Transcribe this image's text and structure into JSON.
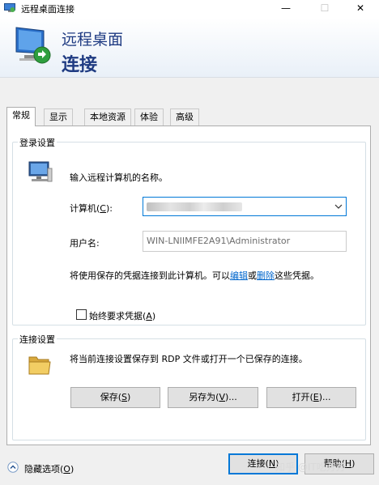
{
  "window": {
    "title": "远程桌面连接"
  },
  "header": {
    "line1": "远程桌面",
    "line2": "连接"
  },
  "tabs": [
    "常规",
    "显示",
    "本地资源",
    "体验",
    "高级"
  ],
  "login_group": {
    "title": "登录设置",
    "prompt": "输入远程计算机的名称。",
    "computer_label_prefix": "计算机(",
    "computer_label_key": "C",
    "computer_label_suffix": "):",
    "username_label": "用户名:",
    "username_value": "WIN-LNIIMFE2A91\\Administrator",
    "cred_text_1": "将使用保存的凭据连接到此计算机。可以",
    "cred_link_edit": "编辑",
    "cred_text_2": "或",
    "cred_link_delete": "删除",
    "cred_text_3": "这些凭据。",
    "checkbox_prefix": "始终要求凭据(",
    "checkbox_key": "A",
    "checkbox_suffix": ")"
  },
  "connection_group": {
    "title": "连接设置",
    "description": "将当前连接设置保存到 RDP 文件或打开一个已保存的连接。",
    "save": {
      "prefix": "保存(",
      "key": "S",
      "suffix": ")"
    },
    "save_as": {
      "prefix": "另存为(",
      "key": "V",
      "suffix": ")..."
    },
    "open": {
      "prefix": "打开(",
      "key": "E",
      "suffix": ")..."
    }
  },
  "footer": {
    "hide_prefix": "隐藏选项(",
    "hide_key": "O",
    "hide_suffix": ")",
    "connect": {
      "prefix": "连接(",
      "key": "N",
      "suffix": ")"
    },
    "help": {
      "prefix": "帮助(",
      "key": "H",
      "suffix": ")"
    }
  },
  "watermark": "知乎 @IT吃芳芳",
  "colors": {
    "accent": "#0078d7",
    "header_text": "#1f3b82",
    "link": "#0066cc"
  }
}
